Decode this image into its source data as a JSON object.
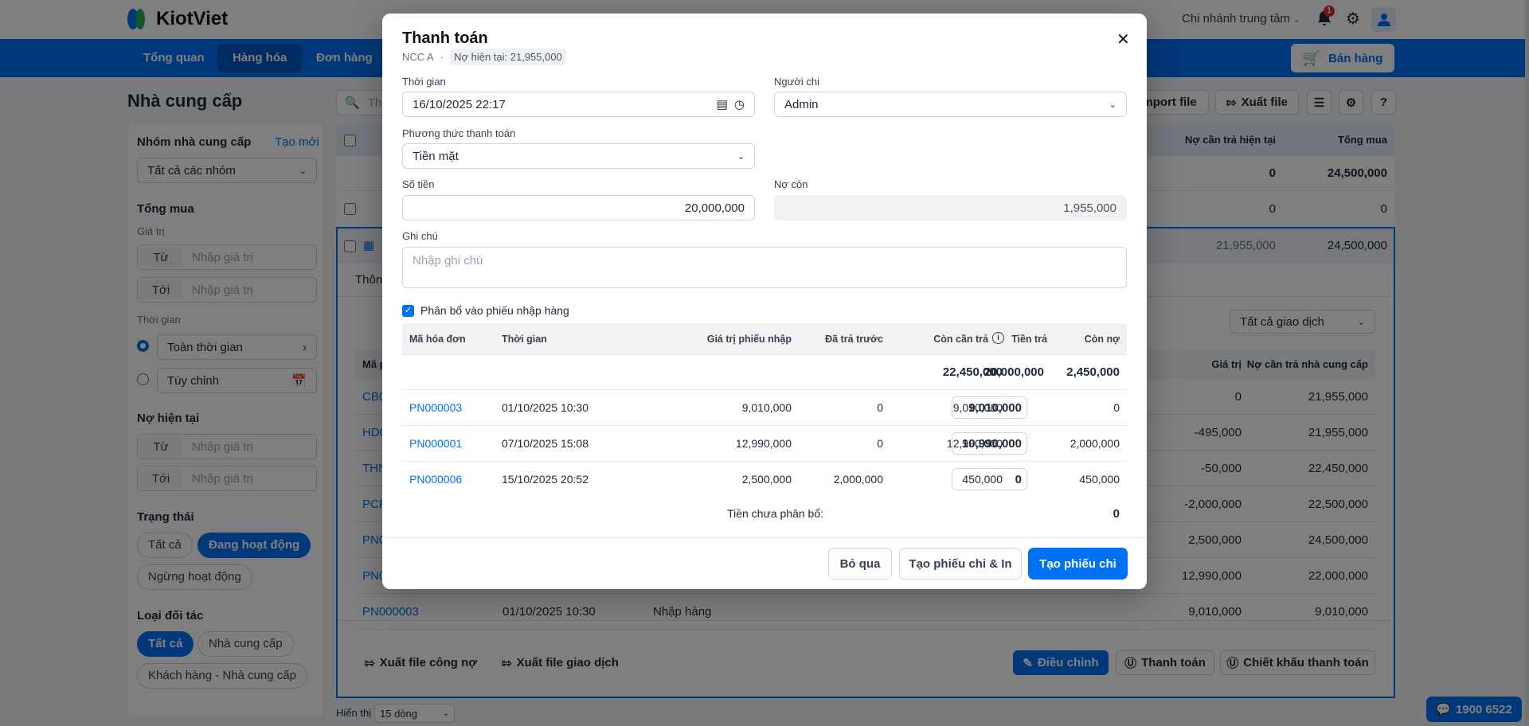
{
  "header": {
    "brand": "KiotViet",
    "branch": "Chi nhánh trung tâm",
    "notification_count": "1",
    "nav": [
      "Tổng quan",
      "Hàng hóa",
      "Đơn hàng"
    ],
    "sell_button": "Bán hàng"
  },
  "page": {
    "title": "Nhà cung cấp",
    "search_placeholder": "The",
    "import_label": "Import file",
    "export_label": "Xuất file"
  },
  "sidebar": {
    "group_title": "Nhóm nhà cung cấp",
    "create_link": "Tạo mới",
    "group_select": "Tất cả các nhóm",
    "total_title": "Tổng mua",
    "value_label": "Giá trị",
    "from": "Từ",
    "to": "Tới",
    "value_placeholder": "Nhập giá trị",
    "time_label": "Thời gian",
    "time_all": "Toàn thời gian",
    "time_custom": "Tùy chỉnh",
    "debt_title": "Nợ hiện tại",
    "status_title": "Trạng thái",
    "status_options": [
      "Tất cả",
      "Đang hoạt động",
      "Ngừng hoạt động"
    ],
    "partner_title": "Loại đối tác",
    "partner_options": [
      "Tất cả",
      "Nhà cung cấp",
      "Khách hàng - Nhà cung cấp"
    ]
  },
  "supplier_table": {
    "headers": {
      "debt": "Nợ cần trả hiện tại",
      "total": "Tổng mua"
    },
    "summary": {
      "debt": "0",
      "total": "24,500,000"
    },
    "row1": {
      "debt": "0",
      "total": "0"
    },
    "expanded": {
      "debt": "21,955,000",
      "total": "24,500,000"
    },
    "tab_partial": "Thôn",
    "filter_select": "Tất cả giao dịch",
    "inner_headers": {
      "code": "Mã p",
      "value": "Giá trị",
      "debt": "Nợ cần trả nhà cung cấp"
    },
    "inner_rows": [
      {
        "code": "CB0",
        "time": "",
        "type": "",
        "value": "0",
        "debt": "21,955,000"
      },
      {
        "code": "HD0",
        "time": "",
        "type": "",
        "value": "-495,000",
        "debt": "21,955,000"
      },
      {
        "code": "THN",
        "time": "",
        "type": "",
        "value": "-50,000",
        "debt": "22,450,000"
      },
      {
        "code": "PCP",
        "time": "",
        "type": "",
        "value": "-2,000,000",
        "debt": "22,500,000"
      },
      {
        "code": "PN0",
        "time": "",
        "type": "",
        "value": "2,500,000",
        "debt": "24,500,000"
      },
      {
        "code": "PN0",
        "time": "",
        "type": "",
        "value": "12,990,000",
        "debt": "22,000,000"
      },
      {
        "code": "PN000003",
        "time": "01/10/2025 10:30",
        "type": "Nhập hàng",
        "value": "9,010,000",
        "debt": "9,010,000"
      }
    ],
    "actions": {
      "export_debt": "Xuất file công nợ",
      "export_tx": "Xuất file giao dịch",
      "adjust": "Điều chỉnh",
      "pay": "Thanh toán",
      "discount": "Chiết khấu thanh toán"
    },
    "page_size_label": "Hiển thị",
    "page_size": "15 dòng"
  },
  "hotline": "1900 6522",
  "modal": {
    "title": "Thanh toán",
    "supplier": "NCC A",
    "separator": "·",
    "current_debt": "Nợ hiện tại: 21,955,000",
    "time_label": "Thời gian",
    "time_value": "16/10/2025 22:17",
    "payer_label": "Người chi",
    "payer_value": "Admin",
    "method_label": "Phương thức thanh toán",
    "method_value": "Tiền mặt",
    "amount_label": "Số tiền",
    "amount_value": "20,000,000",
    "remaining_label": "Nợ còn",
    "remaining_value": "1,955,000",
    "note_label": "Ghi chú",
    "note_placeholder": "Nhập ghi chú",
    "allocate_label": "Phân bổ vào phiếu nhập hàng",
    "allocate_checked": true,
    "table": {
      "headers": [
        "Mã hóa đơn",
        "Thời gian",
        "Giá trị phiếu nhập",
        "Đã trả trước",
        "Còn cần trả",
        "Tiền trả",
        "Còn nợ"
      ],
      "totals": {
        "need": "22,450,000",
        "pay": "20,000,000",
        "debt": "2,450,000"
      },
      "rows": [
        {
          "code": "PN000003",
          "time": "01/10/2025 10:30",
          "value": "9,010,000",
          "paid": "0",
          "need": "9,010,000",
          "pay": "9,010,000",
          "debt": "0"
        },
        {
          "code": "PN000001",
          "time": "07/10/2025 15:08",
          "value": "12,990,000",
          "paid": "0",
          "need": "12,990,000",
          "pay": "10,990,000",
          "debt": "2,000,000"
        },
        {
          "code": "PN000006",
          "time": "15/10/2025 20:52",
          "value": "2,500,000",
          "paid": "2,000,000",
          "need": "450,000",
          "pay": "0",
          "debt": "450,000"
        }
      ]
    },
    "unallocated_label": "Tiền chưa phân bổ:",
    "unallocated_value": "0",
    "cancel": "Bỏ qua",
    "create_print": "Tạo phiếu chi & In",
    "create": "Tạo phiếu chi"
  },
  "colors": {
    "primary": "#0070f4",
    "overlay": "rgba(0,0,0,0.5)"
  }
}
